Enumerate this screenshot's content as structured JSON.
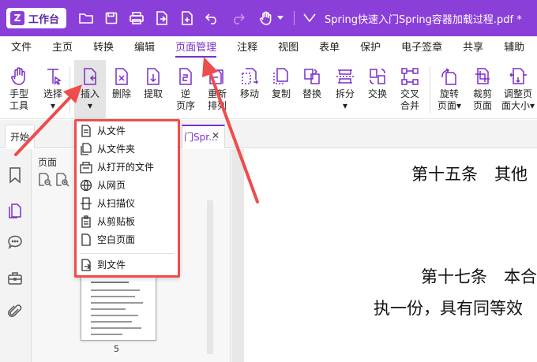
{
  "titlebar": {
    "home_label": "工作台",
    "logo_glyph": "Z",
    "document_title": "Spring快速入门Spring容器加载过程.pdf *",
    "icons": [
      "folder-icon",
      "save-icon",
      "print-icon",
      "export-icon",
      "new-page-icon",
      "undo-icon",
      "redo-icon",
      "hand-icon",
      "dropdown-caret-icon",
      "document-icon"
    ]
  },
  "menubar": {
    "items": [
      "文件",
      "主页",
      "转换",
      "编辑",
      "页面管理",
      "注释",
      "视图",
      "表单",
      "保护",
      "电子签章",
      "共享",
      "辅助"
    ],
    "active": "页面管理"
  },
  "ribbon": {
    "buttons": [
      {
        "line1": "手型",
        "line2": "工具"
      },
      {
        "line1": "选择",
        "line2": "▾"
      },
      {
        "line1": "插入",
        "line2": "▾"
      },
      {
        "line1": "删除",
        "line2": ""
      },
      {
        "line1": "提取",
        "line2": ""
      },
      {
        "line1": "逆",
        "line2": "页序"
      },
      {
        "line1": "重新",
        "line2": "排列"
      },
      {
        "line1": "移动",
        "line2": ""
      },
      {
        "line1": "复制",
        "line2": ""
      },
      {
        "line1": "替换",
        "line2": ""
      },
      {
        "line1": "拆分",
        "line2": "▾"
      },
      {
        "line1": "交换",
        "line2": ""
      },
      {
        "line1": "交叉",
        "line2": "合并"
      },
      {
        "line1": "旋转",
        "line2": "页面▾"
      },
      {
        "line1": "裁剪",
        "line2": "页面"
      },
      {
        "line1": "调整页",
        "line2": "面大小▾"
      }
    ]
  },
  "tabs": {
    "start_label": "开始",
    "doc_label": "门Spr...",
    "close_glyph": "✕"
  },
  "panel": {
    "title": "页面",
    "thumbnail_page_number": "5"
  },
  "insert_menu": {
    "items": [
      "从文件",
      "从文件夹",
      "从打开的文件",
      "从网页",
      "从扫描仪",
      "从剪贴板",
      "空白页面",
      "到文件"
    ]
  },
  "document": {
    "lines": [
      "第十五条　其他",
      "第十七条　本合",
      "执一份，具有同等效"
    ]
  },
  "colors": {
    "brand_purple": "#8b3fd9",
    "accent_purple": "#7a2fc9",
    "annotation_red": "#ef4c4c"
  }
}
